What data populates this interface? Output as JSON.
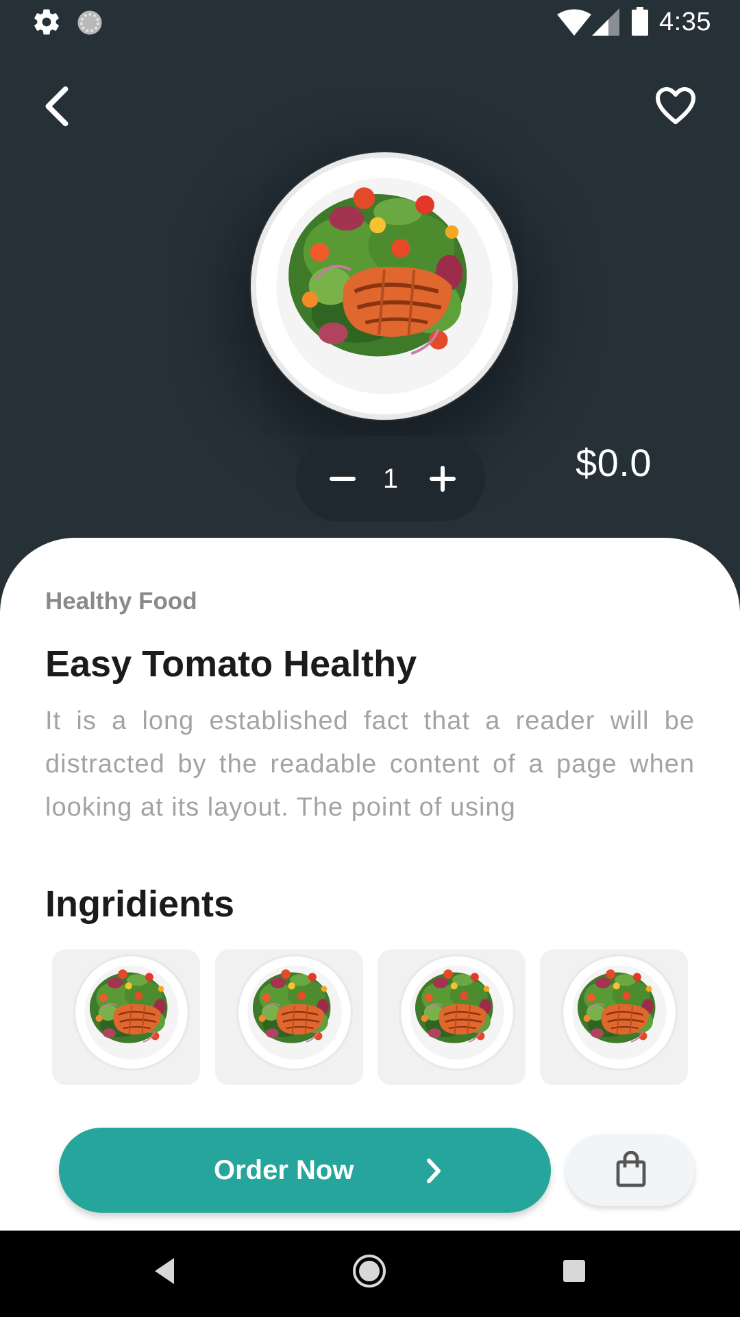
{
  "status_bar": {
    "time": "4:35",
    "icons": [
      "gear-icon",
      "sync-icon",
      "wifi-icon",
      "signal-icon",
      "battery-icon"
    ]
  },
  "header": {
    "back_icon": "chevron-left-icon",
    "favorite_icon": "heart-outline-icon"
  },
  "product": {
    "image": "salmon-salad-plate",
    "quantity": "1",
    "price": "$0.0",
    "category": "Healthy Food",
    "title": "Easy Tomato Healthy",
    "description": "It is a long established fact that a reader will be distracted by the readable content of a page when looking at its layout. The point of using"
  },
  "ingredients": {
    "heading": "Ingridients",
    "items": [
      "salmon-salad-plate",
      "salmon-salad-plate",
      "salmon-salad-plate",
      "salmon-salad-plate"
    ]
  },
  "actions": {
    "order_label": "Order Now",
    "order_icon": "chevron-right-icon",
    "cart_icon": "shopping-bag-icon"
  },
  "nav": {
    "back_icon": "triangle-back-icon",
    "home_icon": "circle-home-icon",
    "recent_icon": "square-recents-icon"
  },
  "colors": {
    "header_bg": "#263037",
    "accent": "#25a59b",
    "sheet_bg": "#ffffff"
  }
}
